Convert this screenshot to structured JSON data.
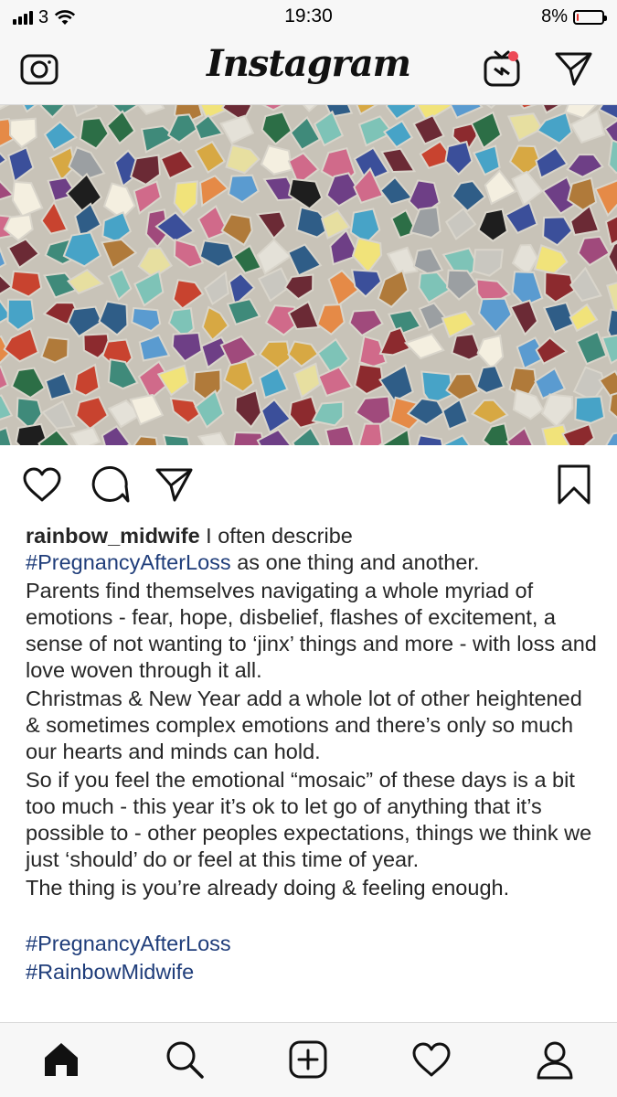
{
  "status_bar": {
    "carrier": "3",
    "time": "19:30",
    "battery_text": "8%",
    "battery_level": 0.08,
    "battery_color": "#e3342f"
  },
  "header": {
    "logo_text": "Instagram",
    "icons": [
      "camera-icon",
      "igtv-icon",
      "direct-message-icon"
    ],
    "notification_dot_color": "#ed4956"
  },
  "post": {
    "image_description_icon": "mosaic-tiles-photo",
    "action_icons": [
      "heart-icon",
      "comment-icon",
      "share-icon",
      "bookmark-icon"
    ],
    "caption": {
      "username": "rainbow_midwife",
      "intro": " I often describe",
      "intro_hashtag": "#PregnancyAfterLoss",
      "intro_rest": " as one thing and another.",
      "paragraphs": [
        "Parents find themselves navigating a whole myriad of emotions - fear, hope, disbelief, flashes of excitement, a sense of not wanting to ‘jinx’ things and more - with loss and love woven through it all.",
        "Christmas & New Year add a whole lot of other heightened & sometimes complex emotions and there’s only so much our hearts and minds can hold.",
        "So if you feel the emotional “mosaic” of these days is a bit too much - this year it’s ok to let go of anything that it’s possible to - other peoples expectations, things we think we just ‘should’ do or feel at this time of year.",
        "The thing is you’re already doing & feeling enough."
      ],
      "hashtags": [
        "#PregnancyAfterLoss",
        "#RainbowMidwife"
      ]
    }
  },
  "tab_bar": {
    "icons": [
      "home-icon",
      "search-icon",
      "new-post-icon",
      "activity-heart-icon",
      "profile-icon"
    ],
    "active": "home"
  },
  "colors": {
    "hashtag": "#1f3d7a",
    "text": "#262626",
    "bar_bg": "#f7f7f7"
  }
}
